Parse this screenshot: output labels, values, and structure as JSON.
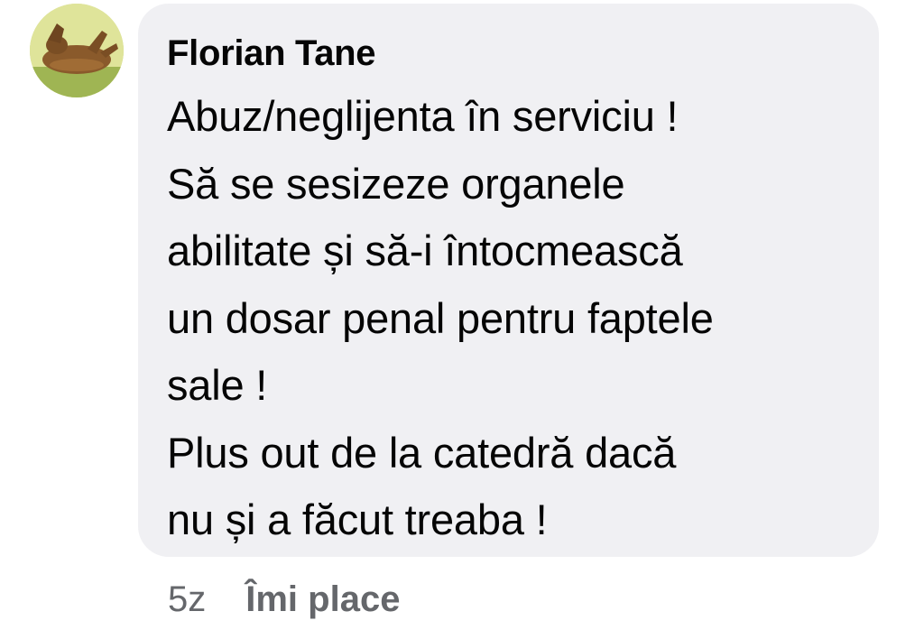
{
  "comment": {
    "author": "Florian Tane",
    "text": "Abuz/neglijenta în serviciu !\nSă se sesizeze organele\nabilitate și să-i întocmească\nun dosar penal pentru faptele\nsale !\nPlus out de la catedră dacă\nnu și a făcut treaba  !",
    "avatar_icon": "profile-photo-animal-icon",
    "bubble_color": "#f0f0f3"
  },
  "footer": {
    "time": "5z",
    "like_label": "Îmi place"
  }
}
